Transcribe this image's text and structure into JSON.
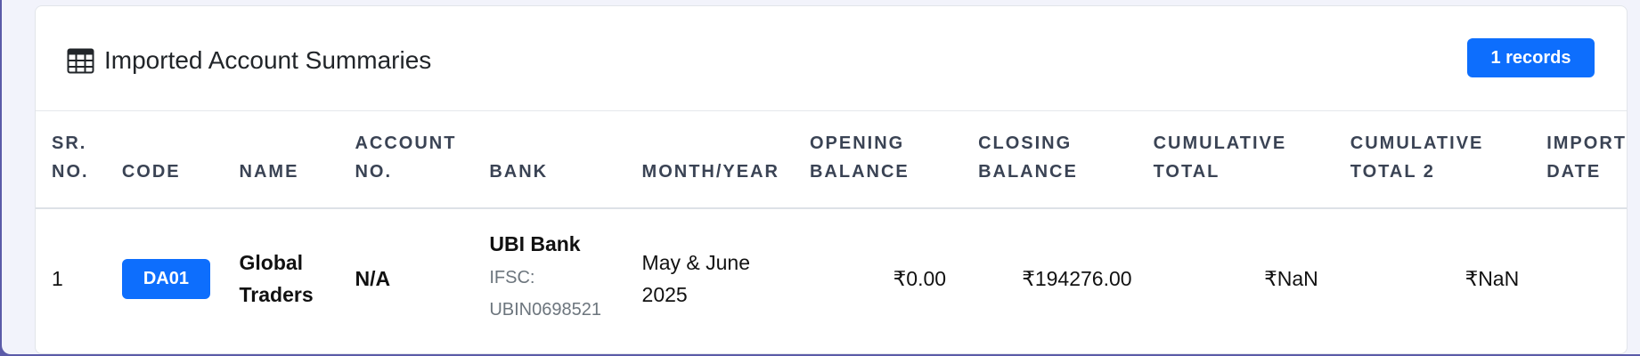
{
  "card": {
    "title": "Imported Account Summaries",
    "title_icon": "table-icon",
    "records_badge": "1 records"
  },
  "table": {
    "headers": {
      "sr": [
        "SR.",
        "NO."
      ],
      "code": [
        "",
        "CODE"
      ],
      "name": [
        "",
        "NAME"
      ],
      "account": [
        "ACCOUNT",
        "NO."
      ],
      "bank": [
        "",
        "BANK"
      ],
      "month": [
        "",
        "MONTH/YEAR"
      ],
      "opening": [
        "OPENING",
        "BALANCE"
      ],
      "closing": [
        "CLOSING",
        "BALANCE"
      ],
      "cumulative": [
        "CUMULATIVE",
        "TOTAL"
      ],
      "cumulative2": [
        "CUMULATIVE",
        "TOTAL 2"
      ],
      "import_date": [
        "IMPORT",
        "DATE"
      ]
    },
    "rows": [
      {
        "sr": "1",
        "code": "DA01",
        "name_line1": "Global",
        "name_line2": "Traders",
        "account": "N/A",
        "bank_name": "UBI Bank",
        "bank_ifsc_label": "IFSC:",
        "bank_ifsc": "UBIN0698521",
        "month_line1": "May & June",
        "month_line2": "2025",
        "opening": "₹0.00",
        "closing": "₹194276.00",
        "cumulative": "₹NaN",
        "cumulative2": "₹NaN",
        "import_date": ""
      }
    ]
  },
  "colors": {
    "primary": "#0d6efd",
    "background": "#5b5ba8",
    "header_text": "#3a4354",
    "muted": "#6c757d"
  }
}
